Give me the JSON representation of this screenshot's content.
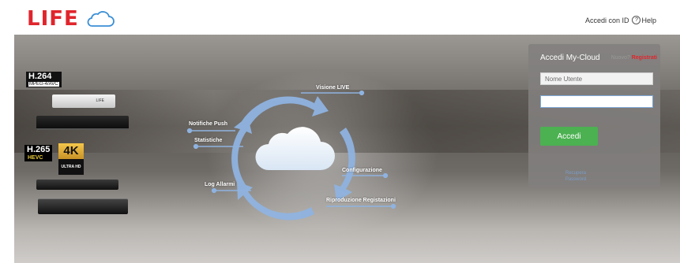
{
  "brand": {
    "logo_text": "LIFE",
    "color": "#e0252c"
  },
  "top_nav": {
    "login_id": "Accedi con ID",
    "help": "Help",
    "help_symbol": "?"
  },
  "left_badges": {
    "h264": {
      "main": "H.264",
      "sub": "MPEG-4/AVC"
    },
    "h265": {
      "main": "H.265",
      "sub": "HEVC"
    },
    "uhd": {
      "main": "4K",
      "sub": "ULTRA HD"
    },
    "device_brand": "LIFE"
  },
  "diagram": {
    "visione_live": "Visione LIVE",
    "notifiche_push": "Notifiche Push",
    "statistiche": "Statistiche",
    "configurazione": "Configurazione",
    "log_allarmi": "Log Allarmi",
    "riproduzione": "Riproduzione Registazioni",
    "accent_color": "#8fb3e0"
  },
  "login_panel": {
    "title": "Accedi My-Cloud",
    "new_prefix": "Nuovo?",
    "register": "Registrati",
    "username_placeholder": "Nome Utente",
    "password_value": "",
    "login_button": "Accedi",
    "forgot_line1": "Recupera",
    "forgot_line2": "Password",
    "button_color": "#4cb151"
  }
}
